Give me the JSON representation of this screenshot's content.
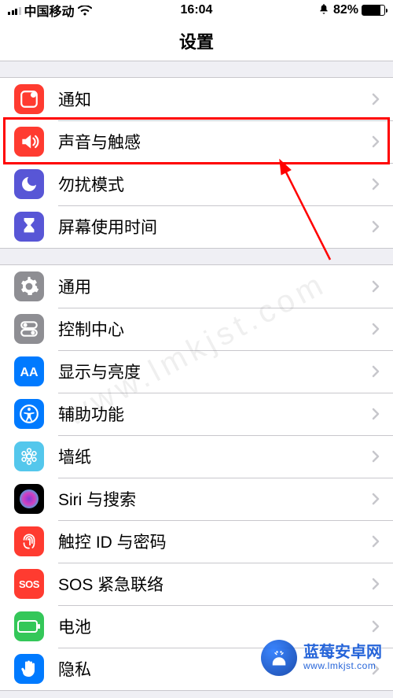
{
  "status": {
    "carrier": "中国移动",
    "time": "16:04",
    "battery_pct": "82%"
  },
  "nav": {
    "title": "设置"
  },
  "sections": [
    {
      "items": [
        {
          "id": "notifications",
          "label": "通知",
          "icon": "notifications-icon",
          "color": "#ff3b30"
        },
        {
          "id": "sounds",
          "label": "声音与触感",
          "icon": "sounds-icon",
          "color": "#ff3b30",
          "highlighted": true
        },
        {
          "id": "dnd",
          "label": "勿扰模式",
          "icon": "moon-icon",
          "color": "#5856d6"
        },
        {
          "id": "screentime",
          "label": "屏幕使用时间",
          "icon": "hourglass-icon",
          "color": "#5856d6"
        }
      ]
    },
    {
      "items": [
        {
          "id": "general",
          "label": "通用",
          "icon": "gear-icon",
          "color": "#8e8e93"
        },
        {
          "id": "control",
          "label": "控制中心",
          "icon": "switches-icon",
          "color": "#8e8e93"
        },
        {
          "id": "display",
          "label": "显示与亮度",
          "icon": "display-icon",
          "color": "#007aff"
        },
        {
          "id": "access",
          "label": "辅助功能",
          "icon": "accessibility-icon",
          "color": "#007aff"
        },
        {
          "id": "wallpaper",
          "label": "墙纸",
          "icon": "wallpaper-icon",
          "color": "#54c7ec"
        },
        {
          "id": "siri",
          "label": "Siri 与搜索",
          "icon": "siri-icon",
          "color": "#000000"
        },
        {
          "id": "touchid",
          "label": "触控 ID 与密码",
          "icon": "fingerprint-icon",
          "color": "#ff3b30"
        },
        {
          "id": "sos",
          "label": "SOS 紧急联络",
          "icon": "sos-icon",
          "color": "#ff3b30",
          "icon_text": "SOS"
        },
        {
          "id": "battery",
          "label": "电池",
          "icon": "battery-icon",
          "color": "#34c759"
        },
        {
          "id": "privacy",
          "label": "隐私",
          "icon": "hand-icon",
          "color": "#007aff"
        }
      ]
    }
  ],
  "watermark": {
    "title": "蓝莓安卓网",
    "url": "www.lmkjst.com",
    "diag": "www.lmkjst.com"
  }
}
